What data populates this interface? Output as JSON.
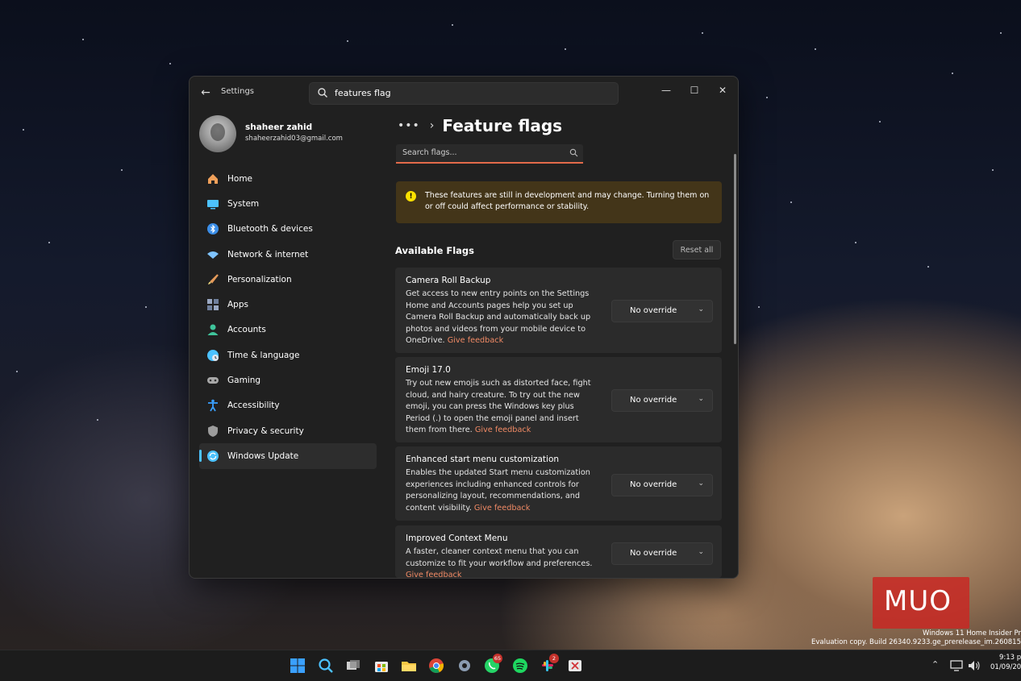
{
  "window": {
    "app_title": "Settings",
    "search_value": "features flag",
    "controls": {
      "minimize": "—",
      "maximize": "☐",
      "close": "✕"
    }
  },
  "profile": {
    "name": "shaheer zahid",
    "email": "shaheerzahid03@gmail.com"
  },
  "sidebar": {
    "items": [
      {
        "label": "Home",
        "icon": "home-icon",
        "color": "#f0a05a"
      },
      {
        "label": "System",
        "icon": "system-icon",
        "color": "#4cc2ff"
      },
      {
        "label": "Bluetooth & devices",
        "icon": "bluetooth-icon",
        "color": "#3b8ee8"
      },
      {
        "label": "Network & internet",
        "icon": "network-icon",
        "color": "#7fc4ff"
      },
      {
        "label": "Personalization",
        "icon": "brush-icon",
        "color": "#e59a5a"
      },
      {
        "label": "Apps",
        "icon": "apps-icon",
        "color": "#9aa8c2"
      },
      {
        "label": "Accounts",
        "icon": "accounts-icon",
        "color": "#3fc49b"
      },
      {
        "label": "Time & language",
        "icon": "globe-icon",
        "color": "#4cc2ff"
      },
      {
        "label": "Gaming",
        "icon": "gaming-icon",
        "color": "#a8a8a8"
      },
      {
        "label": "Accessibility",
        "icon": "accessibility-icon",
        "color": "#3aa0ff"
      },
      {
        "label": "Privacy & security",
        "icon": "shield-icon",
        "color": "#9c9c9c"
      },
      {
        "label": "Windows Update",
        "icon": "update-icon",
        "color": "#4cc2ff",
        "active": true
      }
    ]
  },
  "content": {
    "page_title": "Feature flags",
    "search_placeholder": "Search flags...",
    "warning": "These features are still in development and may change. Turning them on or off could affect performance or stability.",
    "section_title": "Available Flags",
    "reset_label": "Reset all",
    "flags": [
      {
        "title": "Camera Roll Backup",
        "description": "Get access to new entry points on the Settings Home and Accounts pages help you set up Camera Roll Backup and automatically back up photos and videos from your mobile device to OneDrive.",
        "feedback": "Give feedback",
        "value": "No override"
      },
      {
        "title": "Emoji 17.0",
        "description": "Try out new emojis such as distorted face, fight cloud, and hairy creature. To try out the new emoji, you can press the Windows key plus Period (.) to open the emoji panel and insert them from there.",
        "feedback": "Give feedback",
        "value": "No override"
      },
      {
        "title": "Enhanced start menu customization",
        "description": "Enables the updated Start menu customization experiences including enhanced controls for personalizing layout, recommendations, and content visibility.",
        "feedback": "Give feedback",
        "value": "No override"
      },
      {
        "title": "Improved Context Menu",
        "description": "A faster, cleaner context menu that you can customize to fit your workflow and preferences.",
        "feedback": "Give feedback",
        "value": "No override"
      }
    ]
  },
  "taskbar": {
    "badges": {
      "whatsapp": "65",
      "slack": "2"
    },
    "time": "9:13 p",
    "date": "01/09/20"
  },
  "watermark": {
    "logo": "MUO",
    "eval_line1": "Windows 11 Home Insider Pr",
    "eval_line2": "Evaluation copy. Build 26340.9233.ge_prerelease_im.260815"
  }
}
